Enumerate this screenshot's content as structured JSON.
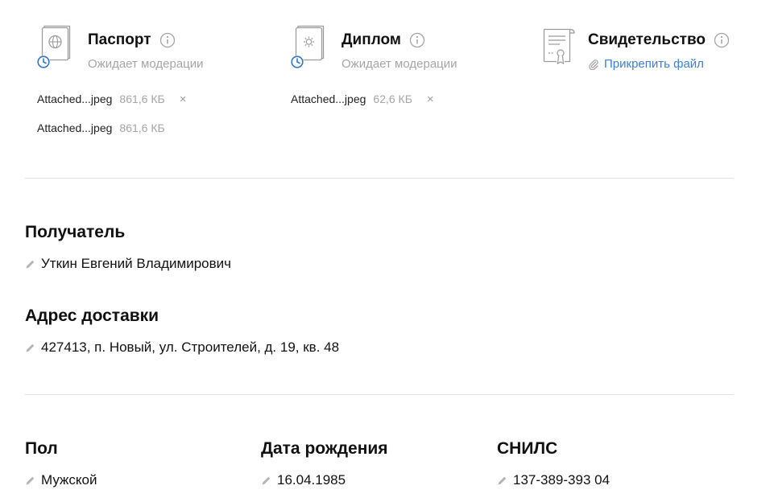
{
  "documents": [
    {
      "title": "Паспорт",
      "icon": "passport-icon",
      "status": "Ожидает модерации",
      "files": [
        {
          "name": "Attached...jpeg",
          "size": "861,6 КБ",
          "removable": true
        },
        {
          "name": "Attached...jpeg",
          "size": "861,6 КБ",
          "removable": false
        }
      ]
    },
    {
      "title": "Диплом",
      "icon": "diploma-icon",
      "status": "Ожидает модерации",
      "files": [
        {
          "name": "Attached...jpeg",
          "size": "62,6 КБ",
          "removable": true
        }
      ]
    },
    {
      "title": "Свидетельство",
      "icon": "certificate-icon",
      "attach_label": "Прикрепить файл"
    }
  ],
  "recipient": {
    "label": "Получатель",
    "value": "Уткин Евгений Владимирович"
  },
  "delivery_address": {
    "label": "Адрес доставки",
    "value": "427413, п. Новый, ул. Строителей, д. 19, кв. 48"
  },
  "gender": {
    "label": "Пол",
    "value": "Мужской"
  },
  "birth_date": {
    "label": "Дата рождения",
    "value": "16.04.1985"
  },
  "snils": {
    "label": "СНИЛС",
    "value": "137-389-393 04"
  },
  "colors": {
    "accent": "#3d7fd6",
    "clock": "#2f74d0",
    "muted": "#a5a5a5",
    "divider": "#e3e3e3",
    "text": "#111111"
  },
  "remove_symbol": "×"
}
